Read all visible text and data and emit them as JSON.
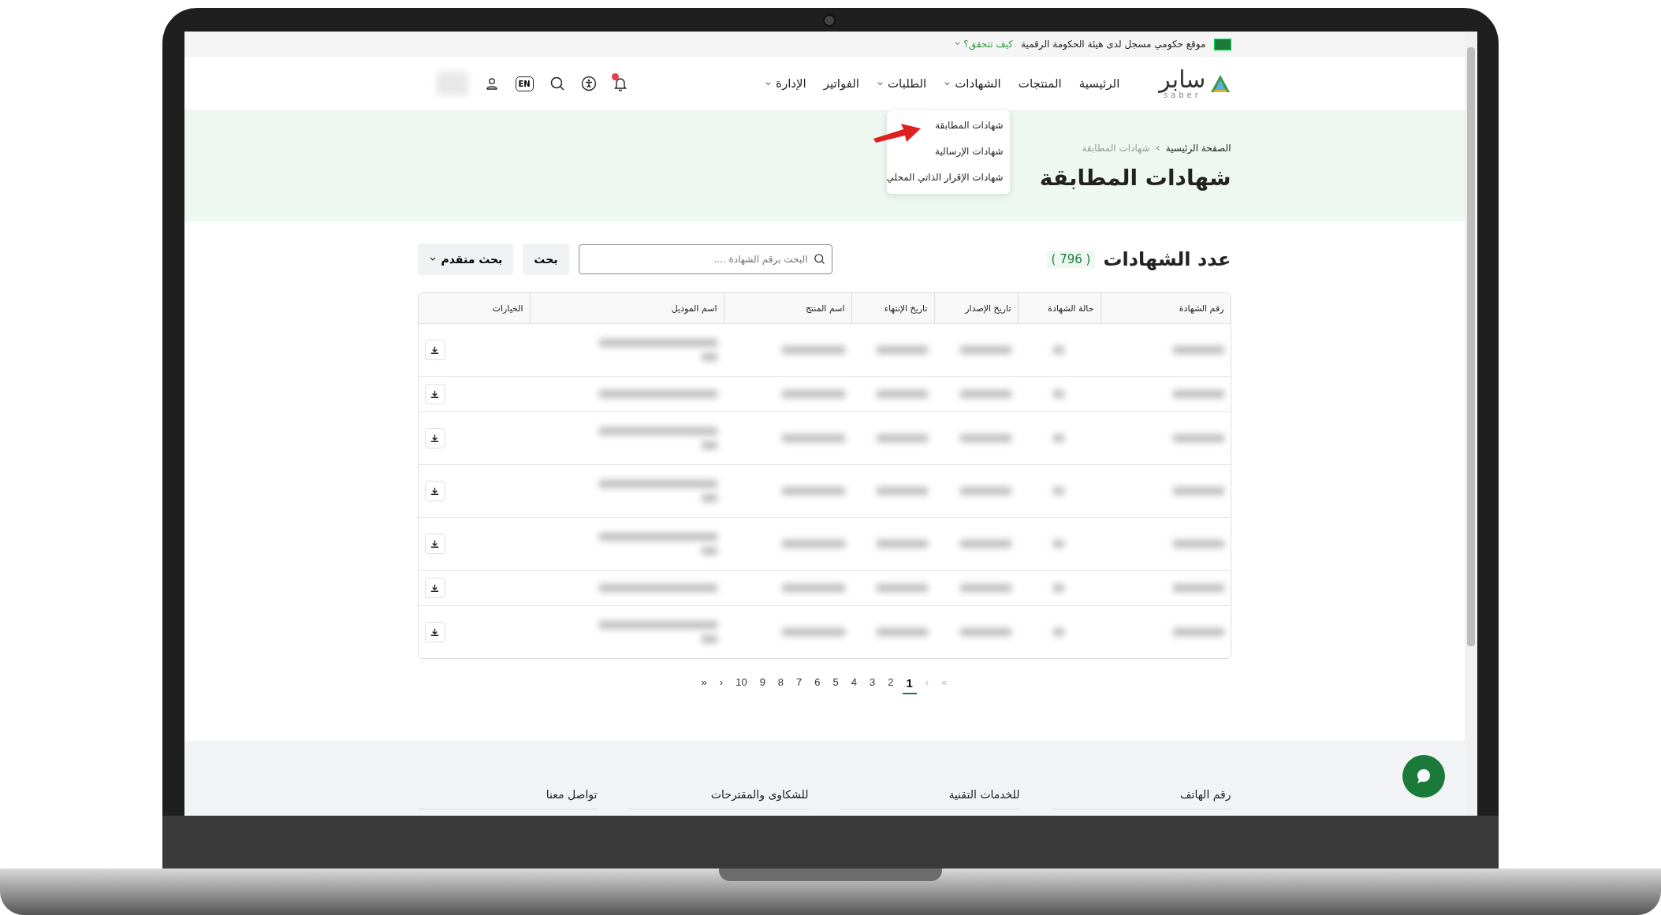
{
  "gov_bar": {
    "text": "موقع حكومي مسجل لدى هيئة الحكومة الرقمية",
    "link": "كيف تتحقق؟"
  },
  "nav": {
    "logo": {
      "arabic": "سابر",
      "latin": "saber"
    },
    "items": [
      {
        "label": "الرئيسية",
        "dropdown": false
      },
      {
        "label": "المنتجات",
        "dropdown": false
      },
      {
        "label": "الشهادات",
        "dropdown": true
      },
      {
        "label": "الطلبات",
        "dropdown": true
      },
      {
        "label": "الفواتير",
        "dropdown": false
      },
      {
        "label": "الإدارة",
        "dropdown": true
      }
    ],
    "has_notification": true,
    "lang_button": "EN"
  },
  "dropdown_menu": [
    "شهادات المطابقة",
    "شهادات الإرسالية",
    "شهادات الإقرار الذاتي المحلي"
  ],
  "breadcrumb": [
    "الصفحة الرئيسية",
    "شهادات المطابقة"
  ],
  "page_title": "شهادات المطابقة",
  "count": {
    "label": "عدد الشهادات",
    "value": "( 796 )"
  },
  "search": {
    "placeholder": "البحث برقم الشهادة ....",
    "button": "بحث",
    "advanced": "بحث متقدم"
  },
  "table": {
    "columns": [
      "رقم الشهادة",
      "حالة الشهادة",
      "تاريخ الإصدار",
      "تاريخ الإنتهاء",
      "اسم المنتج",
      "اسم الموديل",
      "الخيارات"
    ],
    "rows": [
      {
        "kind": "tall"
      },
      {
        "kind": "short"
      },
      {
        "kind": "tall"
      },
      {
        "kind": "tall"
      },
      {
        "kind": "tall"
      },
      {
        "kind": "short"
      },
      {
        "kind": "tall"
      }
    ]
  },
  "pagination": [
    {
      "label": "»",
      "selected": false,
      "disabled": true
    },
    {
      "label": "›",
      "selected": false,
      "disabled": true
    },
    {
      "label": "1",
      "selected": true,
      "disabled": false
    },
    {
      "label": "2",
      "selected": false,
      "disabled": false
    },
    {
      "label": "3",
      "selected": false,
      "disabled": false
    },
    {
      "label": "4",
      "selected": false,
      "disabled": false
    },
    {
      "label": "5",
      "selected": false,
      "disabled": false
    },
    {
      "label": "6",
      "selected": false,
      "disabled": false
    },
    {
      "label": "7",
      "selected": false,
      "disabled": false
    },
    {
      "label": "8",
      "selected": false,
      "disabled": false
    },
    {
      "label": "9",
      "selected": false,
      "disabled": false
    },
    {
      "label": "10",
      "selected": false,
      "disabled": false
    },
    {
      "label": "‹",
      "selected": false,
      "disabled": false
    },
    {
      "label": "«",
      "selected": false,
      "disabled": false
    }
  ],
  "footer_columns": [
    "رقم الهاتف",
    "للخدمات التقنية",
    "للشكاوى والمقترحات",
    "تواصل معنا"
  ]
}
